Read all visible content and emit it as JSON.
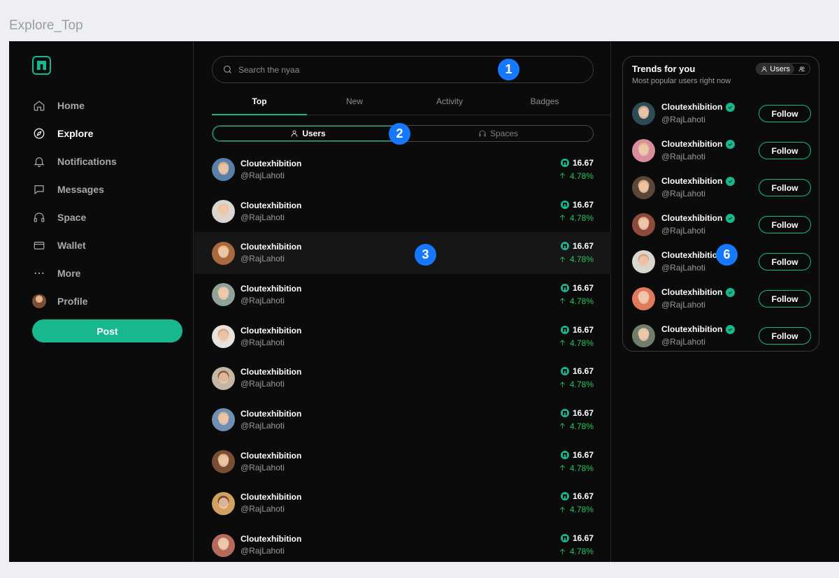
{
  "frame_label": "Explore_Top",
  "sidebar": {
    "items": [
      {
        "label": "Home",
        "icon": "home-icon",
        "active": false
      },
      {
        "label": "Explore",
        "icon": "compass-icon",
        "active": true
      },
      {
        "label": "Notifications",
        "icon": "bell-icon",
        "active": false
      },
      {
        "label": "Messages",
        "icon": "message-icon",
        "active": false
      },
      {
        "label": "Space",
        "icon": "headphones-icon",
        "active": false
      },
      {
        "label": "Wallet",
        "icon": "wallet-icon",
        "active": false
      },
      {
        "label": "More",
        "icon": "more-icon",
        "active": false
      },
      {
        "label": "Profile",
        "icon": "avatar",
        "active": false
      }
    ],
    "post_label": "Post"
  },
  "main": {
    "search_placeholder": "Search the nyaa",
    "tabs": [
      {
        "label": "Top",
        "active": true
      },
      {
        "label": "New",
        "active": false
      },
      {
        "label": "Activity",
        "active": false
      },
      {
        "label": "Badges",
        "active": false
      }
    ],
    "segments": [
      {
        "label": "Users",
        "icon": "user-icon",
        "active": true
      },
      {
        "label": "Spaces",
        "icon": "headphones-icon",
        "active": false
      }
    ],
    "users": [
      {
        "name": "Cloutexhibition",
        "handle": "@RajLahoti",
        "price": "16.67",
        "change": "4.78%"
      },
      {
        "name": "Cloutexhibition",
        "handle": "@RajLahoti",
        "price": "16.67",
        "change": "4.78%"
      },
      {
        "name": "Cloutexhibition",
        "handle": "@RajLahoti",
        "price": "16.67",
        "change": "4.78%"
      },
      {
        "name": "Cloutexhibition",
        "handle": "@RajLahoti",
        "price": "16.67",
        "change": "4.78%"
      },
      {
        "name": "Cloutexhibition",
        "handle": "@RajLahoti",
        "price": "16.67",
        "change": "4.78%"
      },
      {
        "name": "Cloutexhibition",
        "handle": "@RajLahoti",
        "price": "16.67",
        "change": "4.78%"
      },
      {
        "name": "Cloutexhibition",
        "handle": "@RajLahoti",
        "price": "16.67",
        "change": "4.78%"
      },
      {
        "name": "Cloutexhibition",
        "handle": "@RajLahoti",
        "price": "16.67",
        "change": "4.78%"
      },
      {
        "name": "Cloutexhibition",
        "handle": "@RajLahoti",
        "price": "16.67",
        "change": "4.78%"
      },
      {
        "name": "Cloutexhibition",
        "handle": "@RajLahoti",
        "price": "16.67",
        "change": "4.78%"
      }
    ]
  },
  "trends": {
    "title": "Trends for you",
    "subtitle": "Most popular users right now",
    "toggle_users": "Users",
    "follow_label": "Follow",
    "users": [
      {
        "name": "Cloutexhibition",
        "handle": "@RajLahoti",
        "verified": true
      },
      {
        "name": "Cloutexhibition",
        "handle": "@RajLahoti",
        "verified": true
      },
      {
        "name": "Cloutexhibition",
        "handle": "@RajLahoti",
        "verified": true
      },
      {
        "name": "Cloutexhibition",
        "handle": "@RajLahoti",
        "verified": true
      },
      {
        "name": "Cloutexhibition",
        "handle": "@RajLahoti",
        "verified": false
      },
      {
        "name": "Cloutexhibition",
        "handle": "@RajLahoti",
        "verified": true
      },
      {
        "name": "Cloutexhibition",
        "handle": "@RajLahoti",
        "verified": true
      }
    ]
  },
  "markers": [
    "1",
    "2",
    "3",
    "6"
  ],
  "colors": {
    "accent": "#17b890",
    "positive": "#22c55e",
    "marker": "#1677ff",
    "background": "#0b0b0b"
  }
}
